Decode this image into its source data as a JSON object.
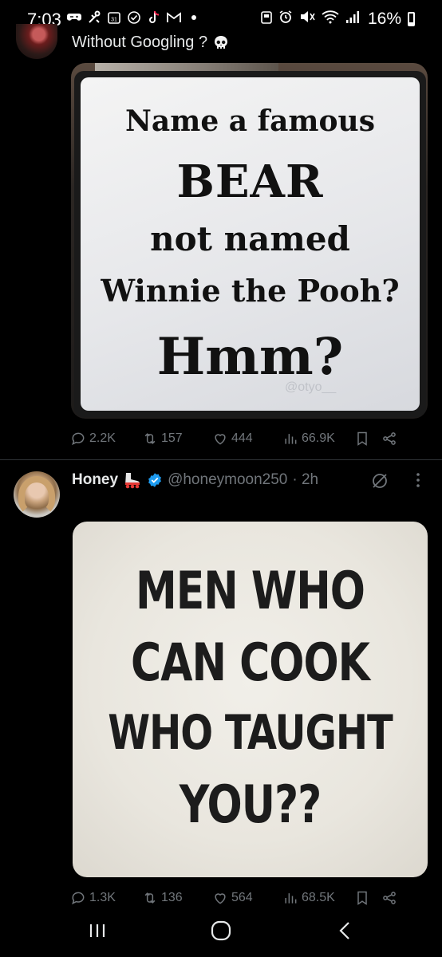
{
  "status_bar": {
    "time": "7:03",
    "battery": "16%"
  },
  "tweet1": {
    "text": "Without Googling ?",
    "image": {
      "lines": [
        "Name a famous",
        "BEAR",
        "not named",
        "Winnie the Pooh?",
        "Hmm?"
      ],
      "watermark": "@otyo__"
    },
    "stats": {
      "replies": "2.2K",
      "reposts": "157",
      "likes": "444",
      "views": "66.9K"
    }
  },
  "tweet2": {
    "name": "Honey",
    "handle": "@honeymoon250",
    "time": "· 2h",
    "image": {
      "lines": [
        "MEN WHO",
        "CAN COOK",
        "WHO TAUGHT",
        "YOU??"
      ]
    },
    "stats": {
      "replies": "1.3K",
      "reposts": "136",
      "likes": "564",
      "views": "68.5K"
    }
  },
  "colors": {
    "background": "#000000",
    "muted": "#71767b",
    "verified": "#1d9bf0"
  },
  "icons": [
    "reply-icon",
    "repost-icon",
    "like-icon",
    "views-icon",
    "bookmark-icon",
    "share-icon",
    "grok-icon",
    "more-icon",
    "recent-apps-icon",
    "home-icon",
    "back-icon"
  ]
}
